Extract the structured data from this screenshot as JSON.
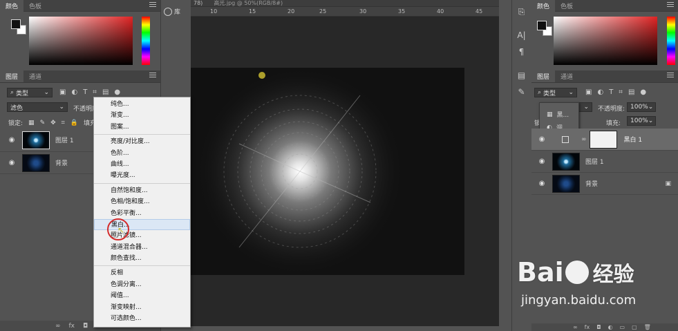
{
  "left_panel": {
    "color_tabs": [
      "颜色",
      "色板"
    ],
    "layer_tabs": [
      "图层",
      "通道"
    ],
    "filter_kind": "类型",
    "blend_mode": "滤色",
    "opacity_label": "不透明度",
    "lock_label": "锁定:",
    "fill_label": "填充",
    "layers": [
      {
        "name": "图层 1"
      },
      {
        "name": "背景"
      }
    ]
  },
  "context_menu": {
    "groups": [
      [
        "纯色...",
        "渐变...",
        "图案..."
      ],
      [
        "亮度/对比度...",
        "色阶...",
        "曲线...",
        "曝光度..."
      ],
      [
        "自然饱和度...",
        "色相/饱和度...",
        "色彩平衡...",
        "黑白...",
        "照片滤镜...",
        "通道混合器...",
        "颜色查找..."
      ],
      [
        "反相",
        "色调分离...",
        "阈值...",
        "渐变映射...",
        "可选颜色..."
      ]
    ],
    "highlighted": "黑白..."
  },
  "document": {
    "tab_title": "高光.jpg @ 50%(RGB/8#)",
    "tab_partial": "78)",
    "library_label": "库",
    "ruler_ticks": [
      "10",
      "15",
      "20",
      "25",
      "30",
      "35",
      "40",
      "45"
    ]
  },
  "right_panel": {
    "color_tabs": [
      "颜色",
      "色板"
    ],
    "layer_tabs": [
      "图层",
      "通道"
    ],
    "filter_kind": "类型",
    "opacity_label": "不透明度:",
    "opacity_value": "100%",
    "lock_label": "锁定:",
    "fill_label": "填充:",
    "fill_value": "100%",
    "popup_items": [
      "黑...",
      "调..."
    ],
    "layers": [
      {
        "name": "黑白 1"
      },
      {
        "name": "图层 1"
      },
      {
        "name": "背景"
      }
    ]
  },
  "watermark": {
    "brand_left": "Bai",
    "brand_right": "经验",
    "url": "jingyan.baidu.com"
  },
  "colors": {
    "ui_bg": "#535353",
    "canvas_bg": "#282828",
    "image_bg": "#121212",
    "highlight_circle": "#d42b2b"
  }
}
